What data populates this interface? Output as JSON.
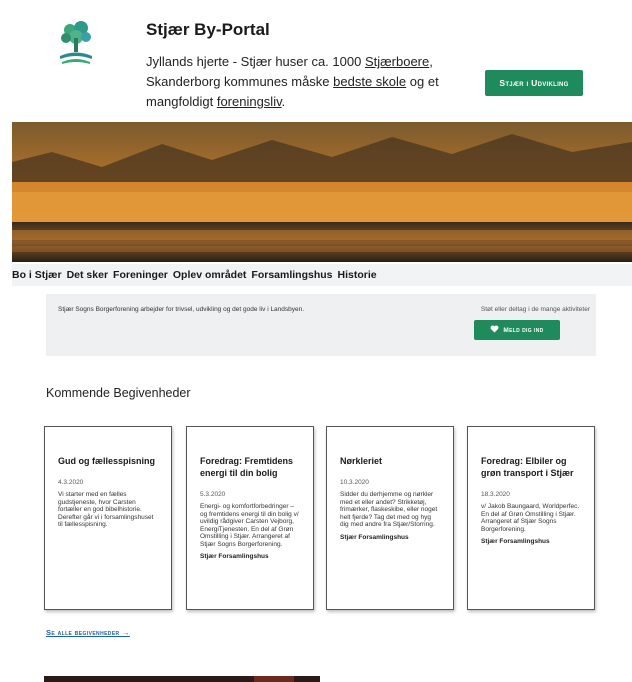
{
  "header": {
    "logo_icon": "tree-wave-logo",
    "title": "Stjær By-Portal",
    "tagline": {
      "part1": "Jyllands hjerte - Stjær huser ca. 1000 ",
      "link1": "Stjærboere",
      "part2": ", Skanderborg kommunes måske ",
      "link2": "bedste skole",
      "part3": " og et mangfoldigt ",
      "link3": "foreningsliv",
      "part4": "."
    },
    "cta_label": "Stjær i Udvikling"
  },
  "nav": {
    "items": [
      "Bo i Stjær",
      "Det sker",
      "Foreninger",
      "Oplev området",
      "Forsamlingshus",
      "Historie"
    ]
  },
  "info": {
    "text": "Stjær Sogns Borgerforening arbejder for trivsel, udvikling og det gode liv i Landsbyen.",
    "right_text": "Støt eller deltag i de mange aktiviteter",
    "join_label": "Meld dig ind",
    "join_icon": "heart-icon"
  },
  "events": {
    "title": "Kommende Begivenheder",
    "cards": [
      {
        "title": "Gud og fællesspisning",
        "date": "4.3.2020",
        "desc": "Vi starter med en fælles gudstjeneste, hvor Carsten fortæller en god bibelhistorie. Derefter går vi i forsamlingshuset til fællesspisning.",
        "location": ""
      },
      {
        "title": "Foredrag: Fremtidens energi til din bolig",
        "date": "5.3.2020",
        "desc": "Energi- og komfortforbedringer – og fremtidens energi til din bolig v/ uvildig rådgiver Carsten Vejborg, EnergiTjenesten. En del af Grøn Omstilling i Stjær. Arrangeret af Stjær Sogns Borgerforening.",
        "location": "Stjær Forsamlingshus"
      },
      {
        "title": "Nørkleriet",
        "date": "10.3.2020",
        "desc": "Sidder du derhjemme og nørkler med et eller andet? Strikketøj, frimærker, flaskeskibe, eller noget helt fjerde? Tag det med og hyg dig med andre fra Stjær/Storring.",
        "location": "Stjær Forsamlingshus"
      },
      {
        "title": "Foredrag: Elbiler og grøn transport i Stjær",
        "date": "18.3.2020",
        "desc": "v/ Jakob Baungaard, Worldperfec. En del af Grøn Omstilling i Stjær. Arrangeret af Stjær Sogns Borgerforening.",
        "location": "Stjær Forsamlingshus"
      }
    ],
    "see_all_label": "Se alle begivenheder →"
  },
  "colors": {
    "brand_green": "#1f8a5b",
    "link_blue": "#1f5fa8",
    "info_bg": "#eef0f2"
  }
}
